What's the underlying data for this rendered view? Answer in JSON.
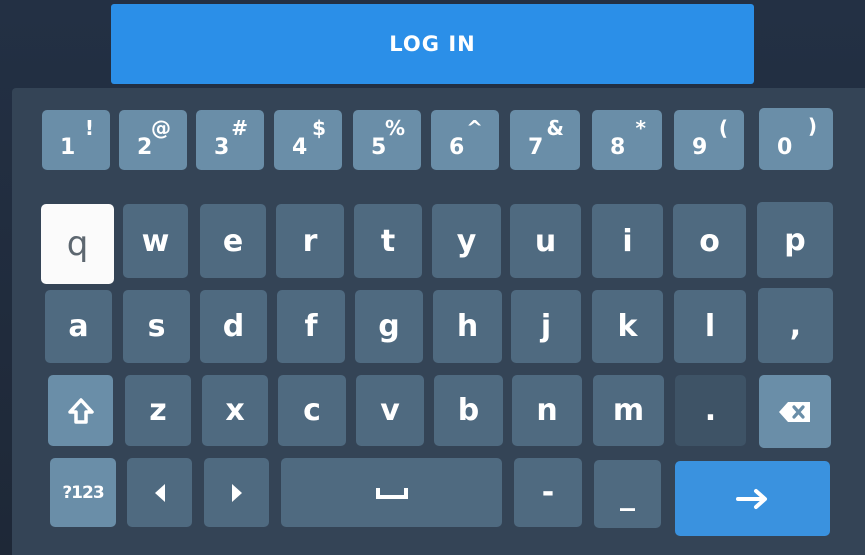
{
  "login": {
    "label": "LOG IN"
  },
  "keyboard": {
    "number_row": [
      {
        "main": "1",
        "alt": "!"
      },
      {
        "main": "2",
        "alt": "@"
      },
      {
        "main": "3",
        "alt": "#"
      },
      {
        "main": "4",
        "alt": "$"
      },
      {
        "main": "5",
        "alt": "%"
      },
      {
        "main": "6",
        "alt": "^"
      },
      {
        "main": "7",
        "alt": "&"
      },
      {
        "main": "8",
        "alt": "*"
      },
      {
        "main": "9",
        "alt": "("
      },
      {
        "main": "0",
        "alt": ")"
      }
    ],
    "row_q": [
      "q",
      "w",
      "e",
      "r",
      "t",
      "y",
      "u",
      "i",
      "o",
      "p"
    ],
    "row_a": [
      "a",
      "s",
      "d",
      "f",
      "g",
      "h",
      "j",
      "k",
      "l",
      ","
    ],
    "row_z": [
      "z",
      "x",
      "c",
      "v",
      "b",
      "n",
      "m",
      "."
    ],
    "bottom": {
      "symbols_label": "?123",
      "dash": "-",
      "underscore": "_"
    },
    "focused_key": "q",
    "icons": {
      "shift": "shift-icon",
      "backspace": "backspace-icon",
      "left": "arrow-left-icon",
      "right": "arrow-right-icon",
      "space": "space-icon",
      "enter": "enter-arrow-icon"
    },
    "colors": {
      "accent": "#2b8fe8",
      "key_light": "#6a8ea8",
      "key": "#4f6a80",
      "panel": "#344456"
    }
  }
}
